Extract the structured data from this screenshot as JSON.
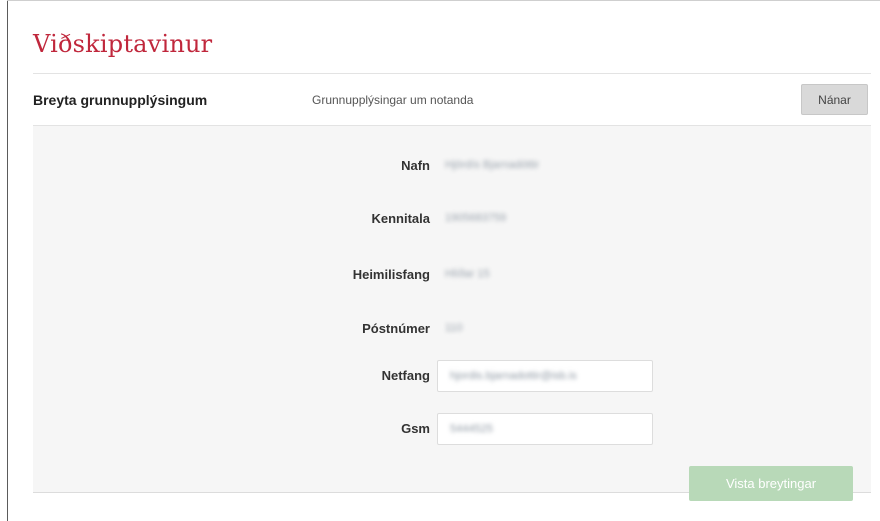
{
  "page": {
    "title": "Viðskiptavinur"
  },
  "section": {
    "name": "Breyta grunnupplýsingum",
    "description": "Grunnupplýsingar um notanda",
    "more_button_label": "Nánar"
  },
  "fields": {
    "name": {
      "label": "Nafn",
      "value": "Hjördís Bjarnadóttir"
    },
    "kennitala": {
      "label": "Kennitala",
      "value": "1905683759"
    },
    "address": {
      "label": "Heimilisfang",
      "value": "Hlíðar 15"
    },
    "postcode": {
      "label": "Póstnúmer",
      "value": "110"
    },
    "email": {
      "label": "Netfang",
      "value": "hjordis.bjarnadottir@isb.is"
    },
    "gsm": {
      "label": "Gsm",
      "value": "5444525"
    }
  },
  "actions": {
    "save_label": "Vista breytingar"
  },
  "colors": {
    "title": "#c0273c",
    "panel_background": "#f6f6f6",
    "save_button": "#b8d9b8",
    "more_button": "#d9d9d9"
  }
}
